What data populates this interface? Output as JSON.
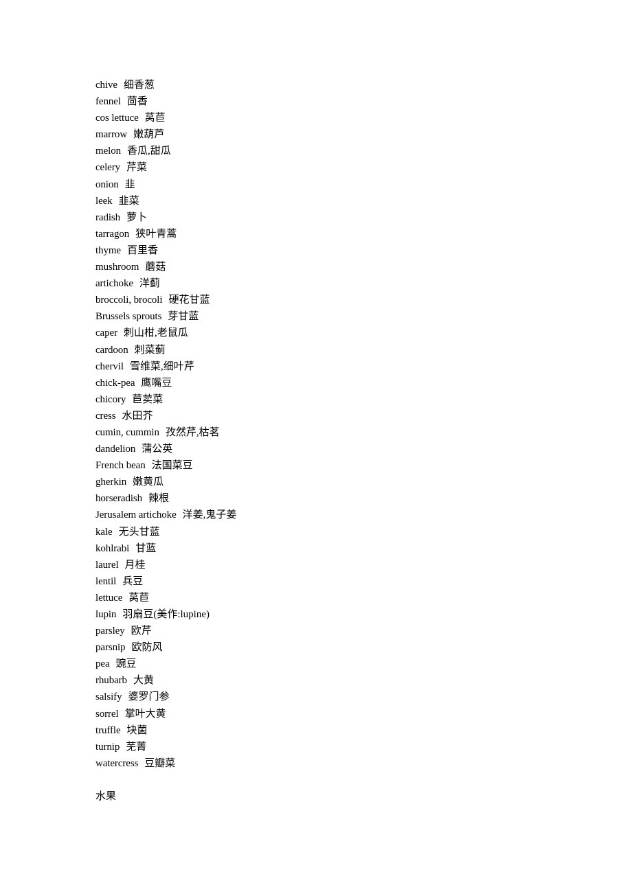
{
  "document": {
    "entries": [
      {
        "en": "chive",
        "zh": "细香葱"
      },
      {
        "en": "fennel",
        "zh": "茴香"
      },
      {
        "en": "cos lettuce",
        "zh": "莴苣"
      },
      {
        "en": "marrow",
        "zh": "嫩葫芦"
      },
      {
        "en": "melon",
        "zh": "香瓜,甜瓜"
      },
      {
        "en": "celery",
        "zh": "芹菜"
      },
      {
        "en": "onion",
        "zh": "韭"
      },
      {
        "en": "leek",
        "zh": "韭菜"
      },
      {
        "en": "radish",
        "zh": "萝卜"
      },
      {
        "en": "tarragon",
        "zh": "狭叶青蒿"
      },
      {
        "en": "thyme",
        "zh": "百里香"
      },
      {
        "en": "mushroom",
        "zh": "蘑菇"
      },
      {
        "en": "artichoke",
        "zh": "洋蓟"
      },
      {
        "en": "broccoli, brocoli",
        "zh": "硬花甘蓝"
      },
      {
        "en": "Brussels sprouts",
        "zh": "芽甘蓝"
      },
      {
        "en": "caper",
        "zh": "刺山柑,老鼠瓜"
      },
      {
        "en": "cardoon",
        "zh": "刺菜蓟"
      },
      {
        "en": "chervil",
        "zh": "雪维菜,细叶芹"
      },
      {
        "en": "chick-pea",
        "zh": "鹰嘴豆"
      },
      {
        "en": "chicory",
        "zh": "苣荬菜"
      },
      {
        "en": "cress",
        "zh": "水田芥"
      },
      {
        "en": "cumin, cummin",
        "zh": "孜然芹,枯茗"
      },
      {
        "en": "dandelion",
        "zh": "蒲公英"
      },
      {
        "en": "French bean",
        "zh": "法国菜豆"
      },
      {
        "en": "gherkin",
        "zh": "嫩黄瓜"
      },
      {
        "en": "horseradish",
        "zh": "辣根"
      },
      {
        "en": "Jerusalem artichoke",
        "zh": "洋姜,鬼子姜"
      },
      {
        "en": "kale",
        "zh": "无头甘蓝"
      },
      {
        "en": "kohlrabi",
        "zh": "甘蓝"
      },
      {
        "en": "laurel",
        "zh": "月桂"
      },
      {
        "en": "lentil",
        "zh": "兵豆"
      },
      {
        "en": "lettuce",
        "zh": "莴苣"
      },
      {
        "en": "lupin",
        "zh": "羽扇豆(美作:lupine)"
      },
      {
        "en": "parsley",
        "zh": "欧芹"
      },
      {
        "en": "parsnip",
        "zh": "欧防风"
      },
      {
        "en": "pea",
        "zh": "豌豆"
      },
      {
        "en": "rhubarb",
        "zh": "大黄"
      },
      {
        "en": "salsify",
        "zh": "婆罗门参"
      },
      {
        "en": "sorrel",
        "zh": "掌叶大黄"
      },
      {
        "en": "truffle",
        "zh": "块菌"
      },
      {
        "en": "turnip",
        "zh": "芜菁"
      },
      {
        "en": "watercress",
        "zh": "豆瓣菜"
      }
    ],
    "next_section_heading": "水果"
  }
}
